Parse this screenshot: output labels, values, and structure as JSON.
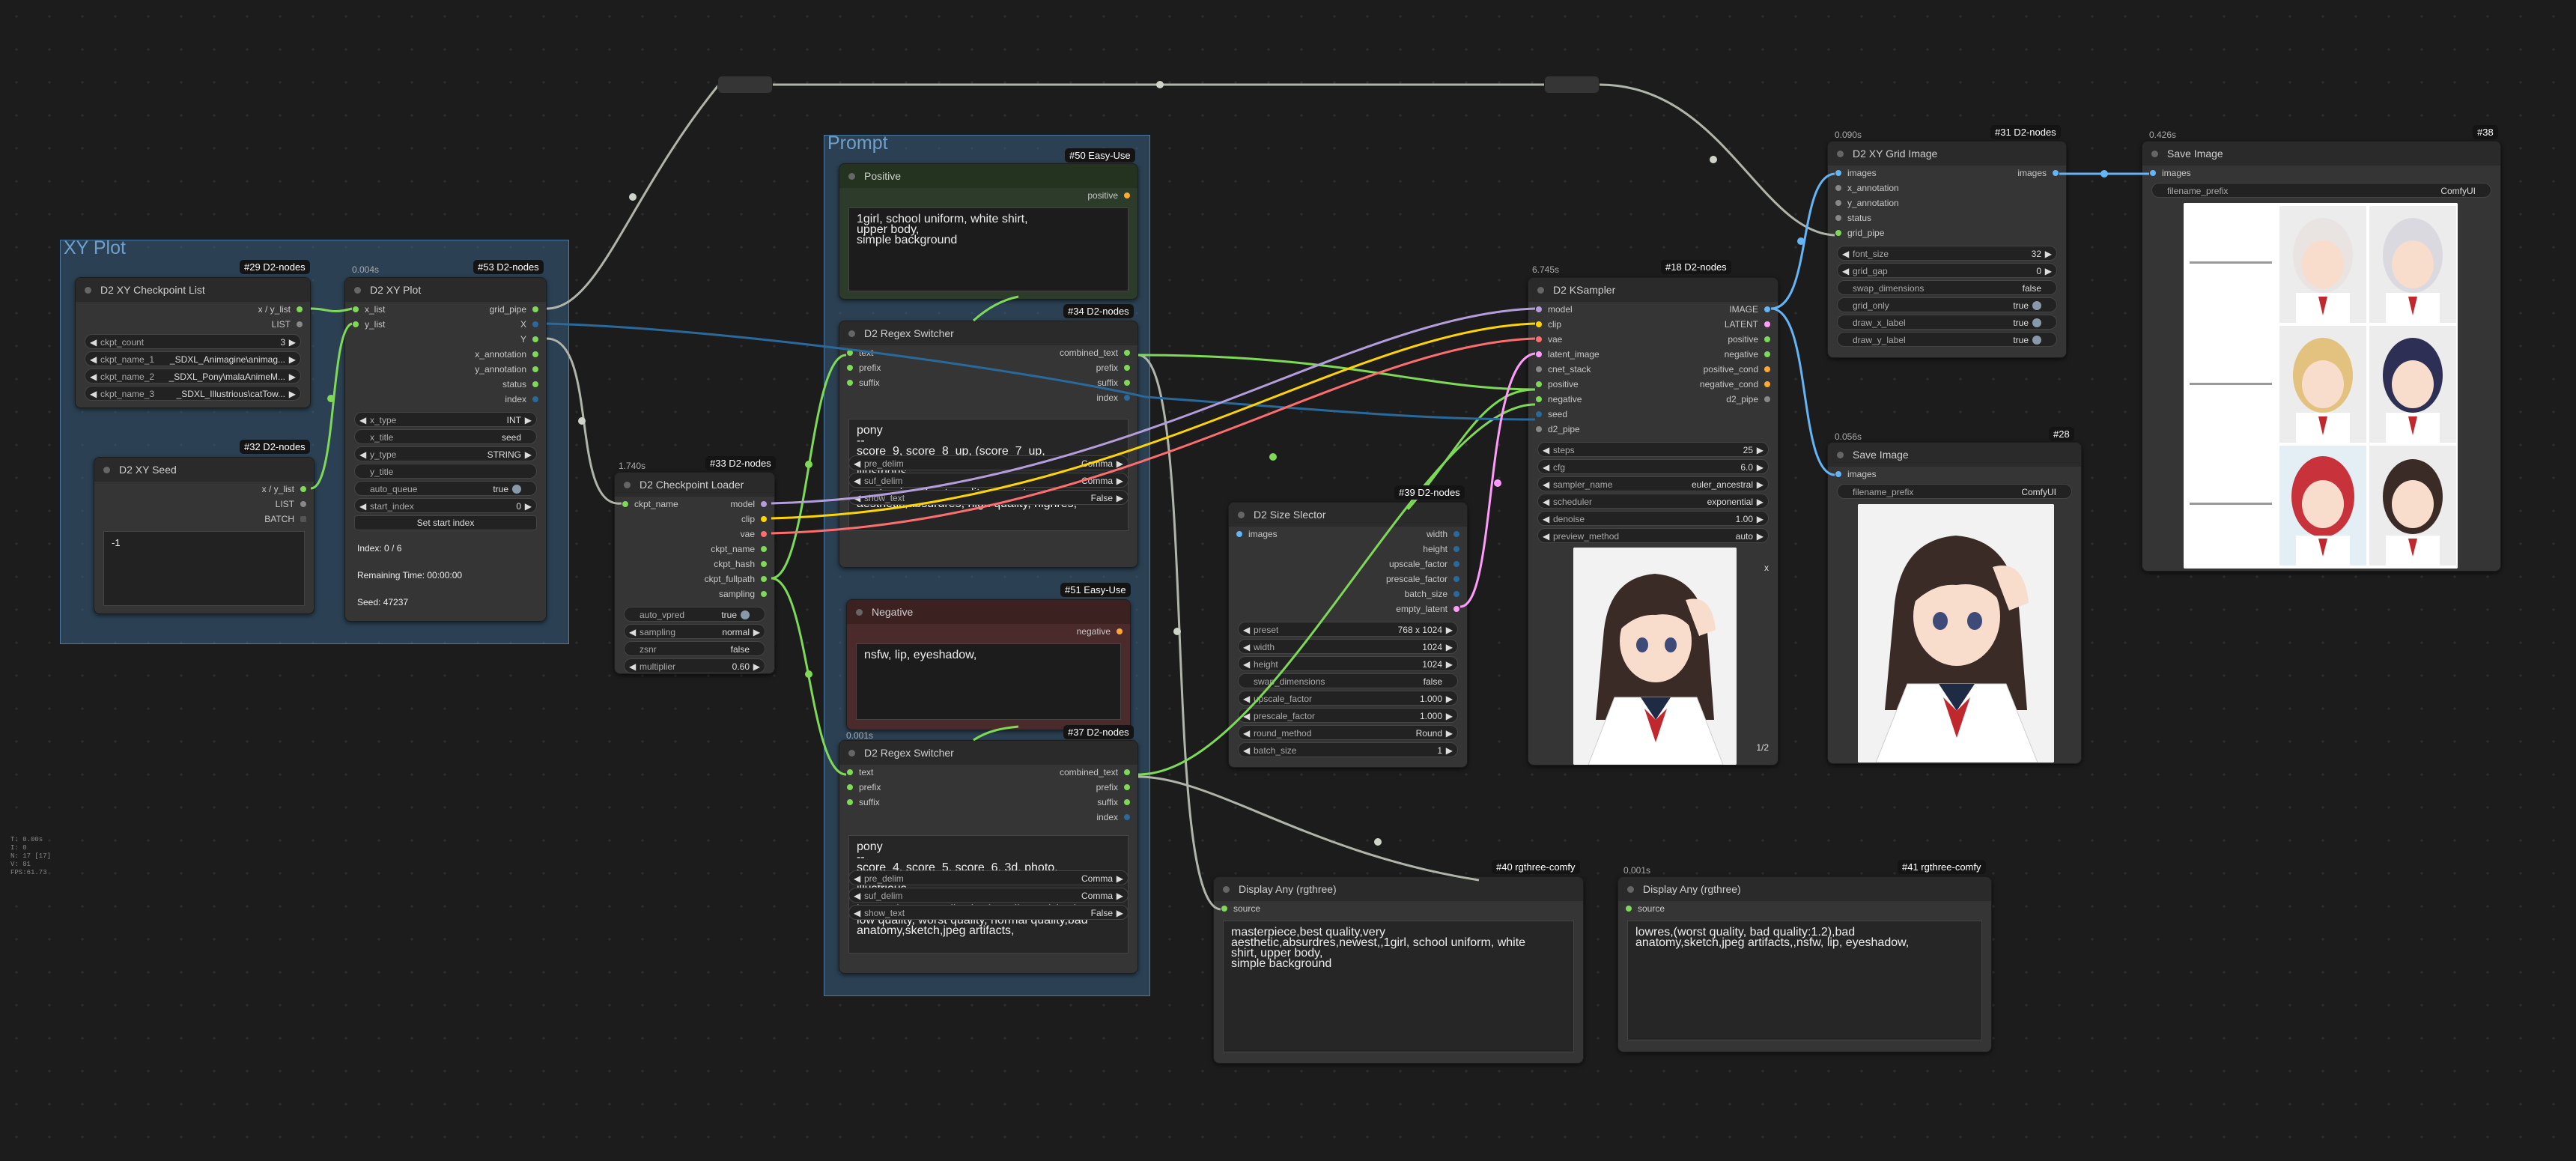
{
  "groups": {
    "xy_plot": "XY Plot",
    "prompt": "Prompt"
  },
  "hud": [
    "T: 0.00s",
    "I: 0",
    "N: 17 [17]",
    "V: 81",
    "FPS:61.73"
  ],
  "colors": {
    "model": "#b39ddb",
    "clip": "#ffd500",
    "vae": "#ff6e6e",
    "conditioning": "#ffa931",
    "latent": "#ff9cf9",
    "image": "#64b5f6",
    "string": "#7ed957",
    "pipe": "#cccccc",
    "int": "#29699c"
  },
  "nodes": {
    "checkpoint_list": {
      "title": "D2 XY Checkpoint List",
      "badge": "#29 D2-nodes",
      "outputs": [
        "x / y_list",
        "LIST"
      ],
      "widgets": [
        {
          "label": "ckpt_count",
          "value": "3"
        },
        {
          "label": "ckpt_name_1",
          "value": "_SDXL_Animagine\\animag..."
        },
        {
          "label": "ckpt_name_2",
          "value": "_SDXL_Pony\\malaAnimeM..."
        },
        {
          "label": "ckpt_name_3",
          "value": "_SDXL_Illustrious\\catTow..."
        }
      ]
    },
    "xy_seed": {
      "title": "D2 XY Seed",
      "badge": "#32 D2-nodes",
      "outputs": [
        "x / y_list",
        "LIST",
        "BATCH"
      ],
      "text": "-1"
    },
    "xy_plot": {
      "title": "D2 XY Plot",
      "badge": "#53 D2-nodes",
      "time": "0.004s",
      "inputs": [
        "x_list",
        "y_list"
      ],
      "outputs": [
        "grid_pipe",
        "X",
        "Y",
        "x_annotation",
        "y_annotation",
        "status",
        "index"
      ],
      "widgets": [
        {
          "label": "x_type",
          "value": "INT"
        },
        {
          "label": "x_title",
          "value": "seed"
        },
        {
          "label": "y_type",
          "value": "STRING"
        },
        {
          "label": "y_title",
          "value": ""
        },
        {
          "label": "auto_queue",
          "value": "true"
        },
        {
          "label": "start_index",
          "value": "0"
        }
      ],
      "button": "Set start index",
      "info": [
        "Index: 0 / 6",
        "Remaining Time: 00:00:00",
        "Seed: 47237"
      ]
    },
    "checkpoint_loader": {
      "title": "D2 Checkpoint Loader",
      "badge": "#33 D2-nodes",
      "time": "1.740s",
      "inputs": [
        "ckpt_name"
      ],
      "outputs": [
        "model",
        "clip",
        "vae",
        "ckpt_name",
        "ckpt_hash",
        "ckpt_fullpath",
        "sampling"
      ],
      "widgets": [
        {
          "label": "auto_vpred",
          "value": "true"
        },
        {
          "label": "sampling",
          "value": "normal"
        },
        {
          "label": "zsnr",
          "value": "false"
        },
        {
          "label": "multiplier",
          "value": "0.60"
        }
      ]
    },
    "positive": {
      "title": "Positive",
      "badge": "#50 Easy-Use",
      "outputs": [
        "positive"
      ],
      "text": "1girl, school uniform, white shirt,\nupper body,\nsimple background"
    },
    "regex1": {
      "title": "D2 Regex Switcher",
      "badge": "#34 D2-nodes",
      "inputs": [
        "text",
        "prefix",
        "suffix"
      ],
      "outputs": [
        "combined_text",
        "prefix",
        "suffix",
        "index"
      ],
      "text": "pony\n--\nscore_9, score_8_up, (score_7_up, score_6_up:0.8) , source_anime, BREAK\nillustrious\n--\nmasterpiece,best quality,newest,\naesthetic,absurdres, high quality, highres,",
      "widgets": [
        {
          "label": "pre_delim",
          "value": "Comma"
        },
        {
          "label": "suf_delim",
          "value": "Comma"
        },
        {
          "label": "show_text",
          "value": "False"
        }
      ]
    },
    "negative": {
      "title": "Negative",
      "badge": "#51 Easy-Use",
      "outputs": [
        "negative"
      ],
      "text": "nsfw, lip, eyeshadow,"
    },
    "regex2": {
      "title": "D2 Regex Switcher",
      "badge": "#37 D2-nodes",
      "time": "0.001s",
      "inputs": [
        "text",
        "prefix",
        "suffix"
      ],
      "outputs": [
        "combined_text",
        "prefix",
        "suffix",
        "index"
      ],
      "text": "pony\n--\nscore_4, score_5, score_6, 3d, photo,\nhyperrealistic, realistic, oil painting,\nillustrious\n--\nlowres,(worst quality, bad quality:1.2),bad\nlow quality, worst quality, normal quality,bad\nanatomy,sketch,jpeg artifacts,",
      "widgets": [
        {
          "label": "pre_delim",
          "value": "Comma"
        },
        {
          "label": "suf_delim",
          "value": "Comma"
        },
        {
          "label": "show_text",
          "value": "False"
        }
      ]
    },
    "size_selector": {
      "title": "D2 Size Slector",
      "badge": "#39 D2-nodes",
      "inputs": [
        "images"
      ],
      "outputs": [
        "width",
        "height",
        "upscale_factor",
        "prescale_factor",
        "batch_size",
        "empty_latent"
      ],
      "widgets": [
        {
          "label": "preset",
          "value": "768 x 1024"
        },
        {
          "label": "width",
          "value": "1024"
        },
        {
          "label": "height",
          "value": "1024"
        },
        {
          "label": "swap_dimensions",
          "value": "false"
        },
        {
          "label": "upscale_factor",
          "value": "1.000"
        },
        {
          "label": "prescale_factor",
          "value": "1.000"
        },
        {
          "label": "round_method",
          "value": "Round"
        },
        {
          "label": "batch_size",
          "value": "1"
        }
      ]
    },
    "ksampler": {
      "title": "D2 KSampler",
      "badge": "#18 D2-nodes",
      "time": "6.745s",
      "inputs": [
        "model",
        "clip",
        "vae",
        "latent_image",
        "cnet_stack",
        "positive",
        "negative",
        "seed",
        "d2_pipe"
      ],
      "outputs": [
        "IMAGE",
        "LATENT",
        "positive",
        "negative",
        "positive_cond",
        "negative_cond",
        "d2_pipe"
      ],
      "widgets": [
        {
          "label": "steps",
          "value": "25"
        },
        {
          "label": "cfg",
          "value": "6.0"
        },
        {
          "label": "sampler_name",
          "value": "euler_ancestral"
        },
        {
          "label": "scheduler",
          "value": "exponential"
        },
        {
          "label": "denoise",
          "value": "1.00"
        },
        {
          "label": "preview_method",
          "value": "auto"
        }
      ],
      "close": "x",
      "page": "1/2"
    },
    "xy_grid": {
      "title": "D2 XY Grid Image",
      "badge": "#31 D2-nodes",
      "time": "0.090s",
      "inputs": [
        "images",
        "x_annotation",
        "y_annotation",
        "status",
        "grid_pipe"
      ],
      "outputs": [
        "images"
      ],
      "widgets": [
        {
          "label": "font_size",
          "value": "32"
        },
        {
          "label": "grid_gap",
          "value": "0"
        },
        {
          "label": "swap_dimensions",
          "value": "false"
        },
        {
          "label": "grid_only",
          "value": "true"
        },
        {
          "label": "draw_x_label",
          "value": "true"
        },
        {
          "label": "draw_y_label",
          "value": "true"
        }
      ]
    },
    "save_small": {
      "title": "Save Image",
      "badge": "#28",
      "time": "0.056s",
      "inputs": [
        "images"
      ],
      "widgets": [
        {
          "label": "filename_prefix",
          "value": "ComfyUI"
        }
      ]
    },
    "save_big": {
      "title": "Save Image",
      "badge": "#38",
      "time": "0.426s",
      "inputs": [
        "images"
      ],
      "widgets": [
        {
          "label": "filename_prefix",
          "value": "ComfyUI"
        }
      ]
    },
    "display1": {
      "title": "Display Any (rgthree)",
      "badge": "#40 rgthree-comfy",
      "inputs": [
        "source"
      ],
      "text": "masterpiece,best quality,very\naesthetic,absurdres,newest,,1girl, school uniform, white\nshirt, upper body,\nsimple background"
    },
    "display2": {
      "title": "Display Any (rgthree)",
      "badge": "#41 rgthree-comfy",
      "time": "0.001s",
      "inputs": [
        "source"
      ],
      "text": "lowres,(worst quality, bad quality:1.2),bad\nanatomy,sketch,jpeg artifacts,,nsfw, lip, eyeshadow,"
    }
  }
}
